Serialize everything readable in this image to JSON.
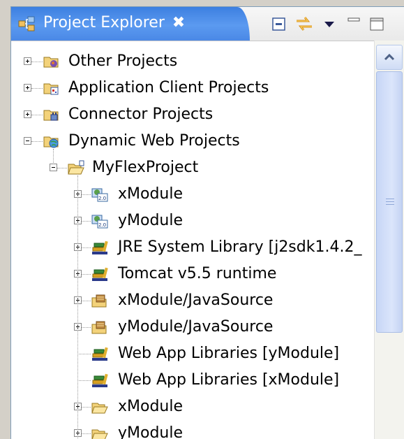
{
  "panel": {
    "title": "Project Explorer",
    "close_label": "✖"
  },
  "toolbar": {
    "collapse_icon": "collapse-all-icon",
    "link_icon": "link-with-editor-icon",
    "menu_icon": "view-menu-icon",
    "minimize_icon": "minimize-icon",
    "maximize_icon": "maximize-icon"
  },
  "tree": [
    {
      "label": "Other Projects",
      "icon": "other-projects-icon",
      "level": 0,
      "expander": "plus"
    },
    {
      "label": "Application Client Projects",
      "icon": "app-client-projects-icon",
      "level": 0,
      "expander": "plus"
    },
    {
      "label": "Connector Projects",
      "icon": "connector-projects-icon",
      "level": 0,
      "expander": "plus"
    },
    {
      "label": "Dynamic Web Projects",
      "icon": "dynamic-web-projects-icon",
      "level": 0,
      "expander": "minus"
    },
    {
      "label": "MyFlexProject",
      "icon": "open-project-icon",
      "level": 1,
      "expander": "minus"
    },
    {
      "label": "xModule",
      "icon": "module-icon",
      "level": 2,
      "expander": "plus"
    },
    {
      "label": "yModule",
      "icon": "module-icon",
      "level": 2,
      "expander": "plus"
    },
    {
      "label": "JRE System Library [j2sdk1.4.2_",
      "icon": "library-icon",
      "level": 2,
      "expander": "plus"
    },
    {
      "label": "Tomcat v5.5 runtime",
      "icon": "library-icon",
      "level": 2,
      "expander": "plus"
    },
    {
      "label": "xModule/JavaSource",
      "icon": "source-folder-icon",
      "level": 2,
      "expander": "plus"
    },
    {
      "label": "yModule/JavaSource",
      "icon": "source-folder-icon",
      "level": 2,
      "expander": "plus"
    },
    {
      "label": "Web App Libraries [yModule]",
      "icon": "library-icon",
      "level": 2,
      "expander": "none"
    },
    {
      "label": "Web App Libraries [xModule]",
      "icon": "library-icon",
      "level": 2,
      "expander": "none"
    },
    {
      "label": "xModule",
      "icon": "folder-icon",
      "level": 2,
      "expander": "plus"
    },
    {
      "label": "yModule",
      "icon": "folder-icon",
      "level": 2,
      "expander": "plus"
    }
  ],
  "colors": {
    "tab_blue": "#4a88e6",
    "scroll_thumb": "#c7d6f6"
  }
}
